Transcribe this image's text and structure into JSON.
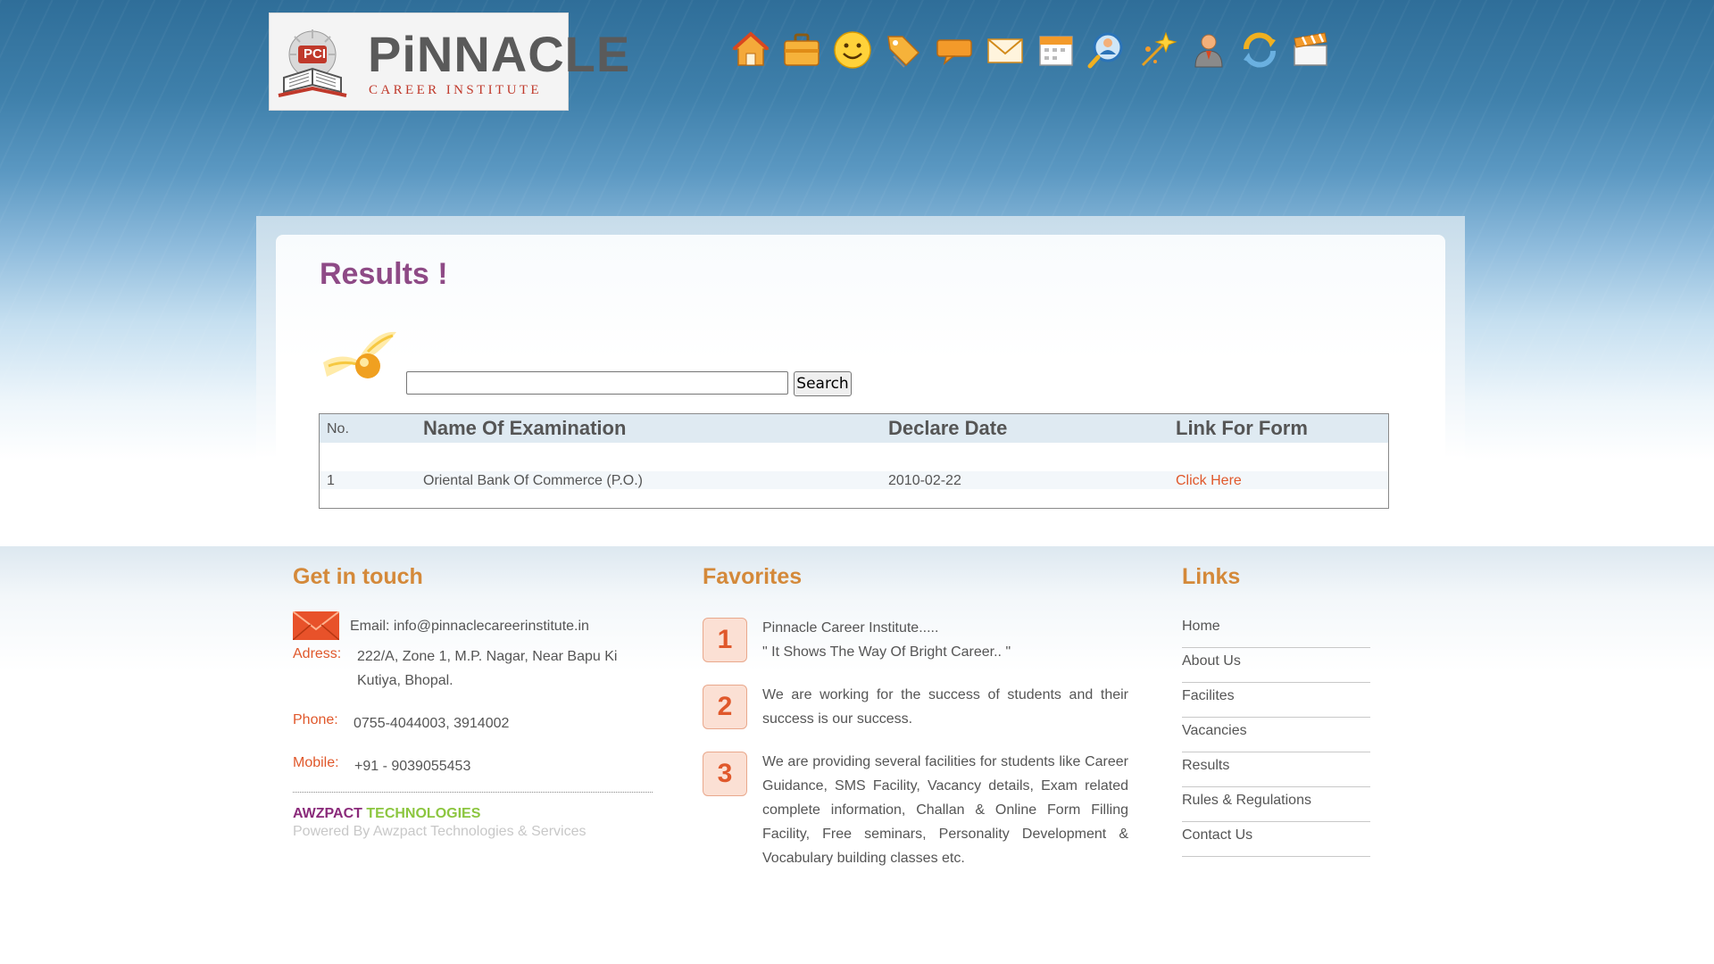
{
  "header": {
    "logo": {
      "wordmark": "PiNNACLE",
      "subtitle": "CAREER INSTITUTE",
      "badge": "PCI"
    },
    "nav_icons": [
      {
        "name": "home-icon"
      },
      {
        "name": "briefcase-icon"
      },
      {
        "name": "smiley-icon"
      },
      {
        "name": "tags-icon"
      },
      {
        "name": "chat-icon"
      },
      {
        "name": "mail-icon"
      },
      {
        "name": "calendar-icon"
      },
      {
        "name": "user-search-icon"
      },
      {
        "name": "sparkle-icon"
      },
      {
        "name": "user-icon"
      },
      {
        "name": "refresh-icon"
      },
      {
        "name": "clapper-icon"
      }
    ]
  },
  "main": {
    "title": "Results !",
    "search": {
      "value": "",
      "button_label": "Search"
    },
    "table": {
      "headers": {
        "no": "No.",
        "name": "Name Of Examination",
        "date": "Declare Date",
        "link": "Link For Form"
      },
      "rows": [
        {
          "no": "1",
          "name": "Oriental Bank Of Commerce (P.O.)",
          "date": "2010-02-22",
          "link": "Click Here"
        }
      ]
    }
  },
  "footer": {
    "contact": {
      "heading": "Get in touch",
      "email": "Email: info@pinnaclecareerinstitute.in",
      "address_label": "Adress:",
      "address_line1": "222/A, Zone 1, M.P. Nagar, Near Bapu Ki",
      "address_line2": "Kutiya, Bhopal.",
      "phone_label": "Phone:",
      "phone": "0755-4044003, 3914002",
      "mobile_label": "Mobile:",
      "mobile": "+91 - 9039055453",
      "brand_part1": "AWZPACT",
      "brand_part2": "TECHNOLOGIES",
      "powered_by": "Powered By Awzpact Technologies & Services"
    },
    "favorites": {
      "heading": "Favorites",
      "items": [
        {
          "num": "1",
          "line1": "Pinnacle Career Institute.....",
          "line2": "\" It Shows The Way Of Bright Career.. \""
        },
        {
          "num": "2",
          "text": "We are working for the success of students and their success is our success."
        },
        {
          "num": "3",
          "text": "We are providing several facilities for students like Career Guidance, SMS Facility, Vacancy details, Exam related complete information, Challan & Online Form Filling Facility, Free seminars, Personality Development & Vocabulary building classes etc."
        }
      ]
    },
    "links": {
      "heading": "Links",
      "items": [
        "Home",
        "About Us",
        "Facilites",
        "Vacancies",
        "Results",
        "Rules & Regulations",
        "Contact Us"
      ]
    }
  },
  "colors": {
    "title_purple": "#8e4a86",
    "footer_heading": "#d4893a",
    "accent_orange": "#e0582b",
    "header_blue": "#3f80ab"
  }
}
